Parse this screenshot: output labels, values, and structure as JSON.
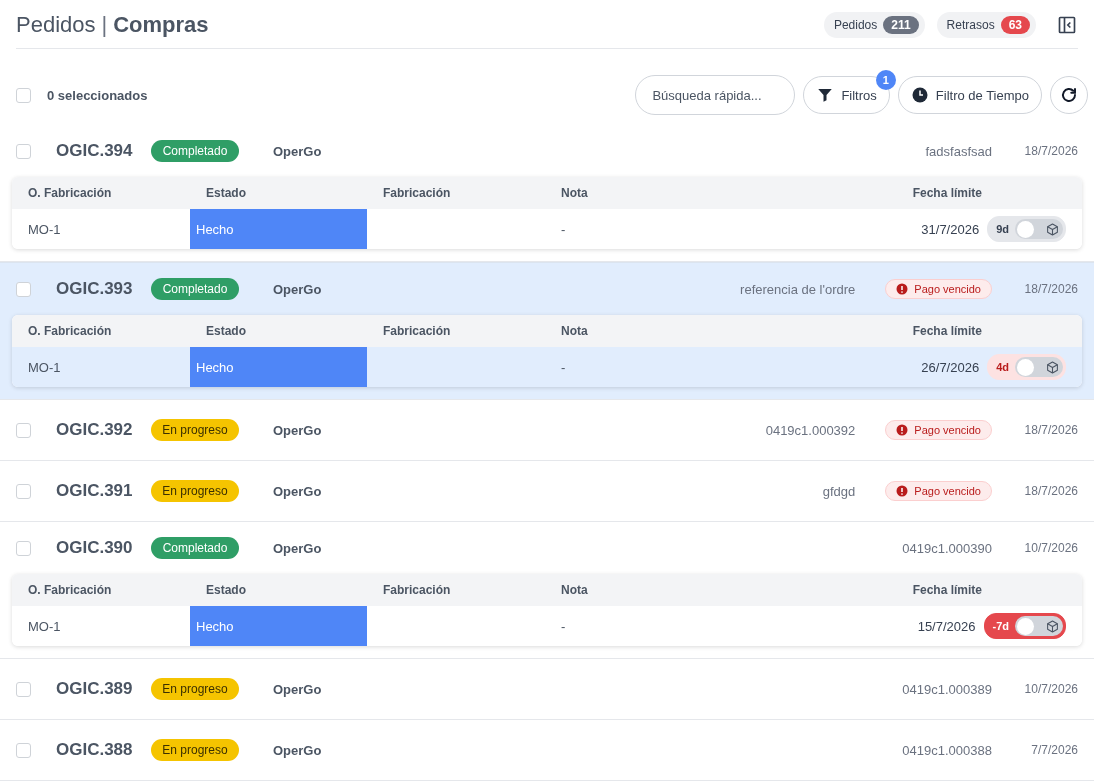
{
  "header": {
    "title_light": "Pedidos",
    "separator": "|",
    "title_bold": "Compras",
    "counters": [
      {
        "label": "Pedidos",
        "count": "211",
        "color": "#6b7280"
      },
      {
        "label": "Retrasos",
        "count": "63",
        "color": "#e5484d"
      }
    ]
  },
  "toolbar": {
    "select_all": {
      "checked": false
    },
    "selection_label": "0 seleccionados",
    "search": {
      "placeholder": "Búsqueda rápida..."
    },
    "filters": {
      "label": "Filtros",
      "badge": "1"
    },
    "time_filter": {
      "label": "Filtro de Tiempo"
    }
  },
  "orders": [
    {
      "id": "OGIC.394",
      "status": "Completado",
      "color": "#2f9e66",
      "client": "OperGo",
      "reference": "fadsfasfsad",
      "date": "18/7/2026",
      "selected": false,
      "checked": false,
      "subtable": {
        "columns": [
          "O. Fabricación",
          "Estado",
          "Fabricación",
          "Nota",
          "Fecha límite"
        ],
        "rows": [
          {
            "order": "MO-1",
            "state": "Hecho",
            "note": "-",
            "deadline": "31/7/2026",
            "days": "9d",
            "color": "#e5e7eb",
            "on": false
          }
        ]
      }
    },
    {
      "id": "OGIC.393",
      "status": "Completado",
      "color": "#2f9e66",
      "client": "OperGo",
      "reference": "referencia de l'ordre",
      "alert": "Pago vencido",
      "date": "18/7/2026",
      "selected": true,
      "checked": false,
      "subtable": {
        "columns": [
          "O. Fabricación",
          "Estado",
          "Fabricación",
          "Nota",
          "Fecha límite"
        ],
        "rows": [
          {
            "order": "MO-1",
            "state": "Hecho",
            "note": "-",
            "deadline": "26/7/2026",
            "days": "4d",
            "color": "#fde2e2",
            "on": false
          }
        ]
      }
    },
    {
      "id": "OGIC.392",
      "status": "En progreso",
      "color": "#f5c400",
      "client": "OperGo",
      "reference": "0419c1.000392",
      "alert": "Pago vencido",
      "date": "18/7/2026",
      "selected": false,
      "checked": false
    },
    {
      "id": "OGIC.391",
      "status": "En progreso",
      "color": "#f5c400",
      "client": "OperGo",
      "reference": "gfdgd",
      "alert": "Pago vencido",
      "date": "18/7/2026",
      "selected": false,
      "checked": false
    },
    {
      "id": "OGIC.390",
      "status": "Completado",
      "color": "#2f9e66",
      "client": "OperGo",
      "reference": "0419c1.000390",
      "date": "10/7/2026",
      "selected": false,
      "checked": false,
      "subtable": {
        "columns": [
          "O. Fabricación",
          "Estado",
          "Fabricación",
          "Nota",
          "Fecha límite"
        ],
        "rows": [
          {
            "order": "MO-1",
            "state": "Hecho",
            "note": "-",
            "deadline": "15/7/2026",
            "days": "-7d",
            "color": "#e5484d",
            "on": false
          }
        ]
      }
    },
    {
      "id": "OGIC.389",
      "status": "En progreso",
      "color": "#f5c400",
      "client": "OperGo",
      "reference": "0419c1.000389",
      "date": "10/7/2026",
      "selected": false,
      "checked": false
    },
    {
      "id": "OGIC.388",
      "status": "En progreso",
      "color": "#f5c400",
      "client": "OperGo",
      "reference": "0419c1.000388",
      "date": "7/7/2026",
      "selected": false,
      "checked": false
    }
  ]
}
